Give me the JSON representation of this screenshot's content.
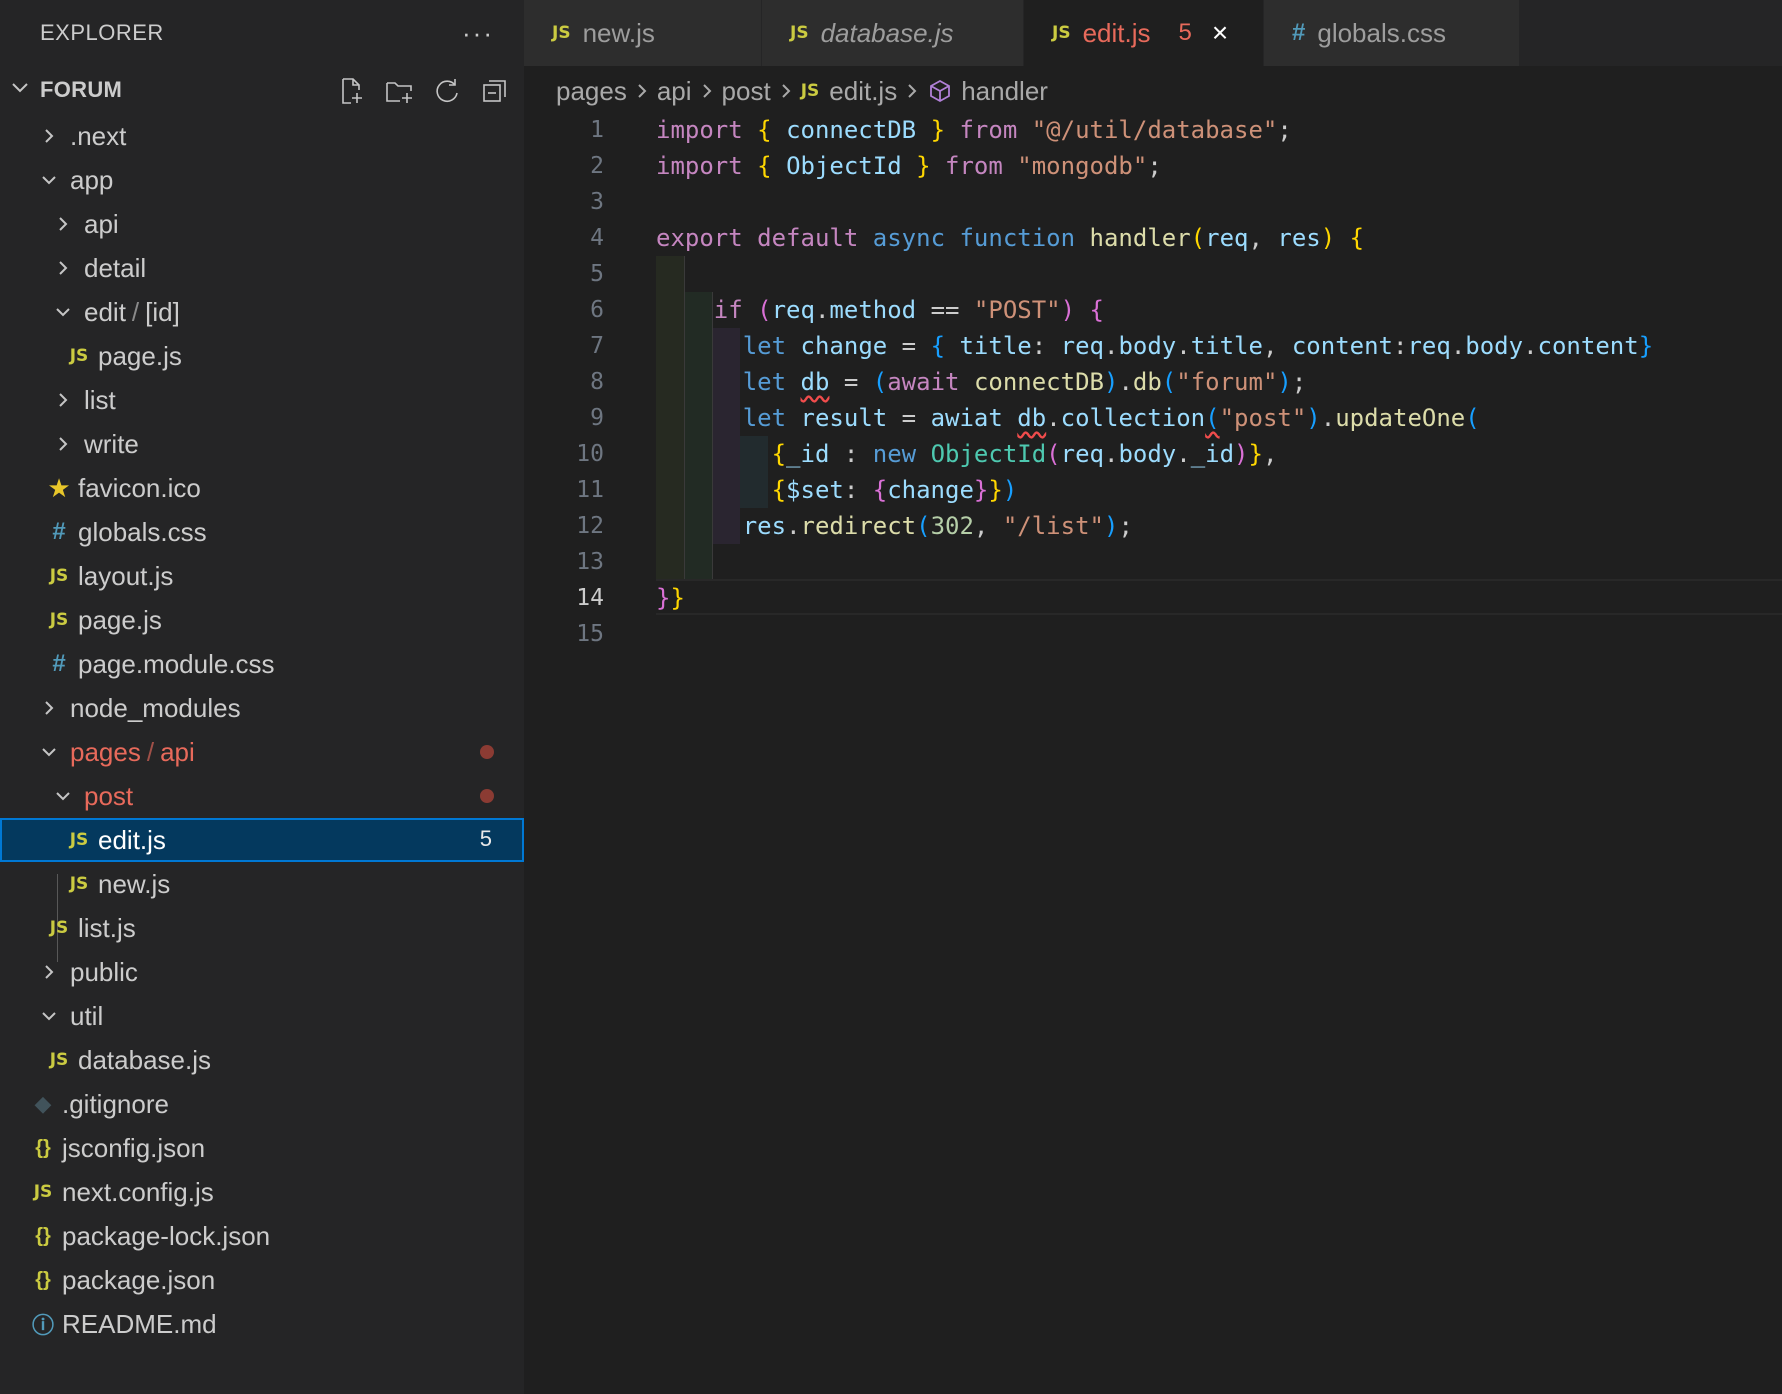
{
  "sidebar": {
    "title": "EXPLORER",
    "more": "···",
    "section": "FORUM"
  },
  "tree": [
    {
      "label": ".next"
    },
    {
      "label": "app"
    },
    {
      "label": "api"
    },
    {
      "label": "detail"
    },
    {
      "label": "edit",
      "suffix": "[id]"
    },
    {
      "label": "page.js"
    },
    {
      "label": "list"
    },
    {
      "label": "write"
    },
    {
      "label": "favicon.ico"
    },
    {
      "label": "globals.css"
    },
    {
      "label": "layout.js"
    },
    {
      "label": "page.js"
    },
    {
      "label": "page.module.css"
    },
    {
      "label": "node_modules"
    },
    {
      "label": "pages",
      "suffix": "api"
    },
    {
      "label": "post"
    },
    {
      "label": "edit.js",
      "badge": "5"
    },
    {
      "label": "new.js"
    },
    {
      "label": "list.js"
    },
    {
      "label": "public"
    },
    {
      "label": "util"
    },
    {
      "label": "database.js"
    },
    {
      "label": ".gitignore"
    },
    {
      "label": "jsconfig.json"
    },
    {
      "label": "next.config.js"
    },
    {
      "label": "package-lock.json"
    },
    {
      "label": "package.json"
    },
    {
      "label": "README.md"
    }
  ],
  "icons": {
    "js": "JS",
    "css": "#",
    "json": "{}",
    "sep": "/",
    "close": "×"
  },
  "tabs": [
    {
      "label": "new.js"
    },
    {
      "label": "database.js"
    },
    {
      "label": "edit.js",
      "errors": "5"
    },
    {
      "label": "globals.css"
    }
  ],
  "breadcrumb": [
    "pages",
    "api",
    "post",
    "edit.js",
    "handler"
  ],
  "editor": {
    "line_numbers": [
      "1",
      "2",
      "3",
      "4",
      "5",
      "6",
      "7",
      "8",
      "9",
      "10",
      "11",
      "12",
      "13",
      "14",
      "15"
    ],
    "current_line": "14"
  },
  "code_tokens": {
    "import": "import",
    "from": "from",
    "export": "export",
    "default": "default",
    "async": "async",
    "function": "function",
    "if": "if",
    "let": "let",
    "await": "await",
    "awiat": "awiat",
    "new": "new",
    "connectDB": "connectDB",
    "ObjectId": "ObjectId",
    "handler": "handler",
    "req": "req",
    "res": "res",
    "method": "method",
    "change": "change",
    "title": "title",
    "body": "body",
    "content": "content",
    "db": "db",
    "result": "result",
    "collection": "collection",
    "updateOne": "updateOne",
    "_id": "_id",
    "set": "$set",
    "redirect": "redirect",
    "s_database": "\"@/util/database\"",
    "s_mongodb": "\"mongodb\"",
    "s_POST": "\"POST\"",
    "s_forum": "\"forum\"",
    "s_post": "\"post\"",
    "s_list": "\"/list\"",
    "n_302": "302"
  },
  "colors": {
    "sidebar_bg": "#252526",
    "editor_bg": "#1f1f1f",
    "selection": "#04395e",
    "focus_border": "#0078d4",
    "git_modified": "#e86a5b",
    "js_icon": "#cbcb41",
    "css_icon": "#519aba"
  }
}
